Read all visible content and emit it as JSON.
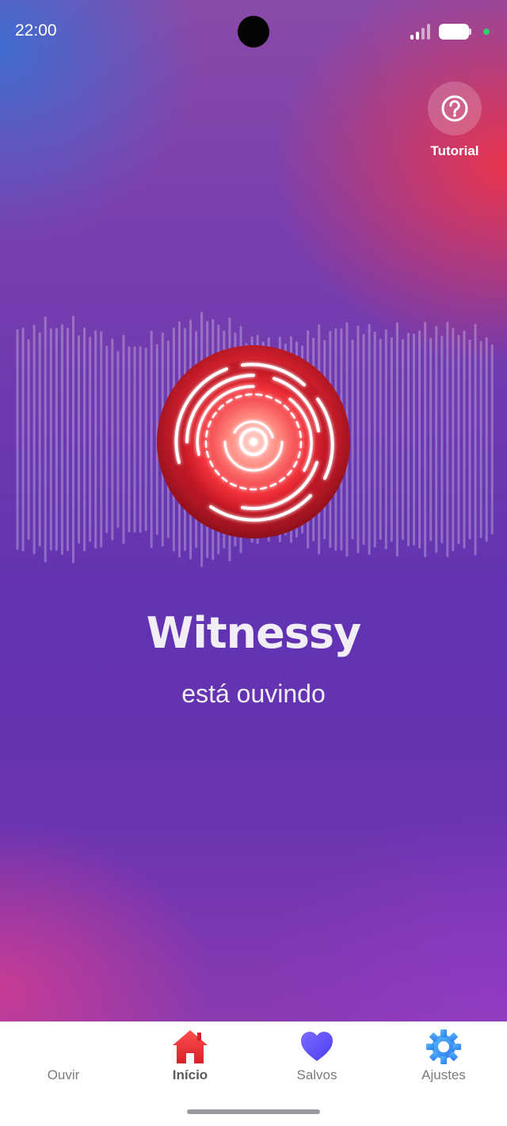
{
  "status_bar": {
    "time": "22:00"
  },
  "tutorial": {
    "label": "Tutorial",
    "icon": "help-circle-icon"
  },
  "main": {
    "title": "Witnessy",
    "subtitle": "está ouvindo",
    "record_icon": "listening-record-icon",
    "accent_color": "#e8262e"
  },
  "nav": {
    "items": [
      {
        "label": "Ouvir",
        "icon": "soundwave-icon",
        "active": false
      },
      {
        "label": "Início",
        "icon": "home-icon",
        "active": true
      },
      {
        "label": "Salvos",
        "icon": "heart-icon",
        "active": false
      },
      {
        "label": "Ajustes",
        "icon": "gear-icon",
        "active": false
      }
    ]
  }
}
